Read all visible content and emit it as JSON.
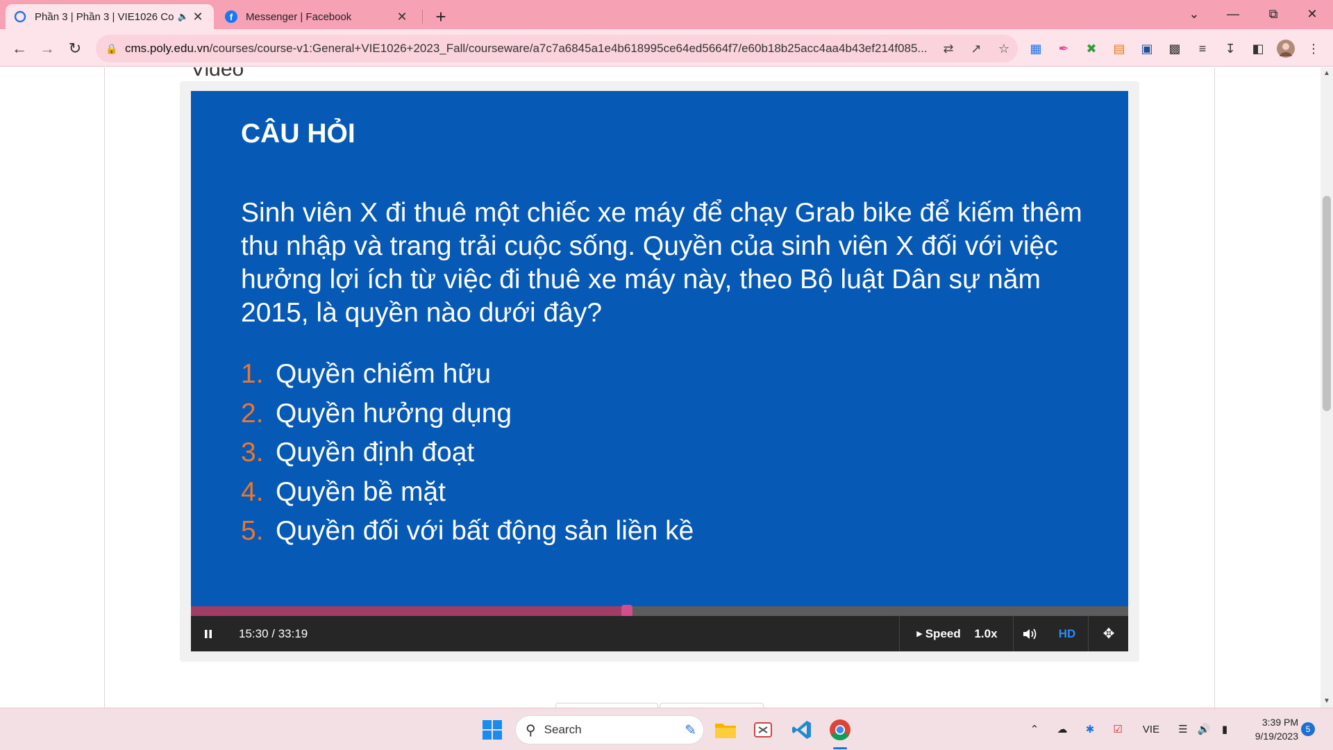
{
  "browser": {
    "tabs": [
      {
        "title": "Phần 3 | Phần 3 | VIE1026 Co",
        "active": true
      },
      {
        "title": "Messenger | Facebook",
        "active": false
      }
    ],
    "new_tab": "+",
    "url_host": "cms.poly.edu.vn",
    "url_path": "/courses/course-v1:General+VIE1026+2023_Fall/courseware/a7c7a6845a1e4b618995ce64ed5664f7/e60b18b25acc4aa4b43ef214f085..."
  },
  "page": {
    "section_title": "Video"
  },
  "slide": {
    "title": "CÂU HỎI",
    "question": "Sinh viên X đi thuê một chiếc xe máy để chạy Grab bike để kiếm thêm thu nhập và trang trải cuộc sống. Quyền của sinh viên X đối với việc hưởng lợi ích từ việc đi thuê xe máy này, theo Bộ luật Dân sự năm 2015, là quyền nào dưới đây?",
    "options": [
      {
        "num": "1.",
        "text": "Quyền chiếm hữu"
      },
      {
        "num": "2.",
        "text": "Quyền hưởng dụng"
      },
      {
        "num": "3.",
        "text": "Quyền định đoạt"
      },
      {
        "num": "4.",
        "text": "Quyền bề mặt"
      },
      {
        "num": "5.",
        "text": "Quyền đối với bất động sản liền kề"
      }
    ]
  },
  "player": {
    "time": "15:30 / 33:19",
    "progress_fraction": 0.465,
    "speed_label": "Speed",
    "speed_value": "1.0x",
    "hd_label": "HD",
    "colors": {
      "played": "#9e3e67",
      "hd": "#2b8cff",
      "slide_bg": "#0659b5",
      "option_number": "#e9772f"
    }
  },
  "taskbar": {
    "search_placeholder": "Search",
    "language": "VIE",
    "time": "3:39 PM",
    "date": "9/19/2023",
    "notification_count": "5"
  }
}
